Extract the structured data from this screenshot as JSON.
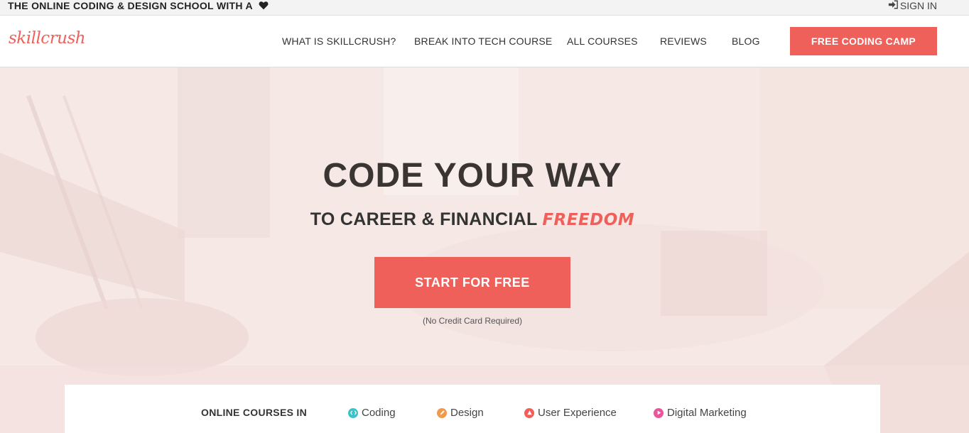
{
  "topbar": {
    "tagline": "THE ONLINE CODING & DESIGN SCHOOL WITH A",
    "tagline_icon": "heart-icon",
    "signin_icon": "sign-in-icon",
    "signin_label": "SIGN IN"
  },
  "header": {
    "logo": "skillcrush",
    "nav": [
      {
        "label": "WHAT IS SKILLCRUSH?"
      },
      {
        "label": "BREAK INTO TECH COURSE"
      },
      {
        "label": "ALL COURSES"
      },
      {
        "label": "REVIEWS"
      },
      {
        "label": "BLOG"
      }
    ],
    "cta": "FREE CODING CAMP"
  },
  "hero": {
    "headline": "CODE YOUR WAY",
    "subline": "TO CAREER & FINANCIAL",
    "accent": "FREEDOM",
    "button": "START FOR FREE",
    "note": "(No Credit Card Required)"
  },
  "courses": {
    "label": "ONLINE COURSES IN",
    "items": [
      {
        "label": "Coding",
        "icon": "code-icon",
        "color": "#3cc3c8"
      },
      {
        "label": "Design",
        "icon": "pencil-icon",
        "color": "#f39a4a"
      },
      {
        "label": "User Experience",
        "icon": "ux-triangle-icon",
        "color": "#f0605a"
      },
      {
        "label": "Digital Marketing",
        "icon": "play-icon",
        "color": "#e9579a"
      }
    ]
  },
  "colors": {
    "accent": "#f0605a"
  }
}
